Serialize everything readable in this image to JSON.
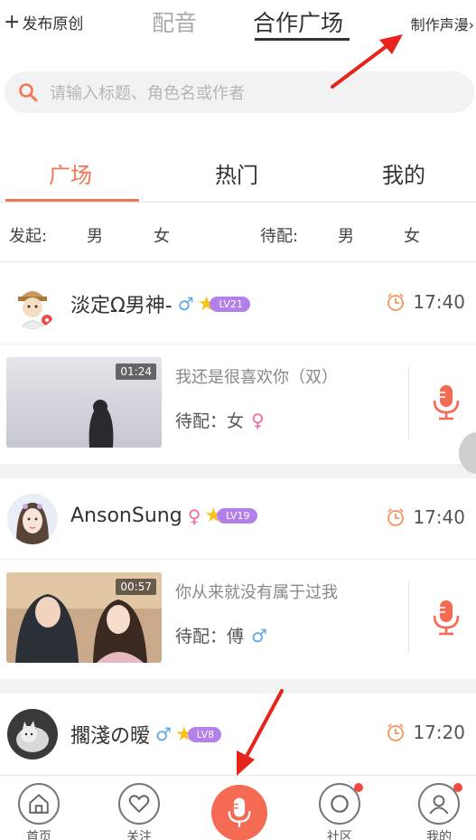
{
  "topbar": {
    "publish_label": "发布原创",
    "tab_dub": "配音",
    "tab_coop": "合作广场",
    "make_label": "制作声漫"
  },
  "search": {
    "placeholder": "请输入标题、角色名或作者"
  },
  "tabs": [
    {
      "label": "广场"
    },
    {
      "label": "热门"
    },
    {
      "label": "我的"
    }
  ],
  "filter": {
    "start_label": "发起:",
    "start_male": "男",
    "start_female": "女",
    "wait_label": "待配:",
    "wait_male": "男",
    "wait_female": "女"
  },
  "cards": [
    {
      "user": "淡定Ω男神-",
      "gender_symbol": "♂",
      "level": "LV21",
      "time": "17:40",
      "duration": "01:24",
      "title": "我还是很喜欢你（双）",
      "need_prefix": "待配：",
      "need_value": "女",
      "need_symbol": "♀"
    },
    {
      "user": "AnsonSung",
      "gender_symbol": "♀",
      "level": "LV19",
      "time": "17:40",
      "duration": "00:57",
      "title": "你从来就没有属于过我",
      "need_prefix": "待配：",
      "need_value": "傅",
      "need_symbol": "♂"
    },
    {
      "user": "擱淺の暧",
      "gender_symbol": "♂",
      "level": "LV8",
      "time": "17:20"
    }
  ],
  "nav": {
    "home": "首页",
    "follow": "关注",
    "community": "社区",
    "mine": "我的"
  },
  "colors": {
    "accent": "#f47553",
    "mic": "#f46a52",
    "level_badge": "#b37fe8",
    "badge_dot": "#f0493d"
  }
}
